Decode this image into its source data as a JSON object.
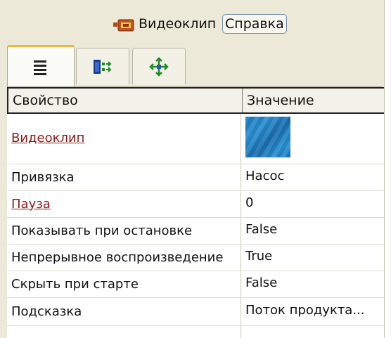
{
  "header": {
    "icon": "video-clip-icon",
    "title": "Видеоклип",
    "help_label": "Справка"
  },
  "tabs": [
    {
      "icon": "property-list-icon",
      "active": true
    },
    {
      "icon": "events-icon",
      "active": false
    },
    {
      "icon": "move-arrows-icon",
      "active": false
    }
  ],
  "grid": {
    "columns": [
      "Свойство",
      "Значение"
    ],
    "rows": [
      {
        "property": "Видеоклип",
        "value": "",
        "link": true,
        "value_type": "color-swatch"
      },
      {
        "property": "Привязка",
        "value": "Насос",
        "link": false
      },
      {
        "property": "Пауза",
        "value": "0",
        "link": true
      },
      {
        "property": "Показывать при остановке",
        "value": "False",
        "link": false
      },
      {
        "property": "Непрерывное воспроизведение",
        "value": "True",
        "link": false
      },
      {
        "property": "Скрыть при старте",
        "value": "False",
        "link": false
      },
      {
        "property": "Подсказка",
        "value": "Поток продукта...",
        "link": false
      }
    ]
  },
  "colors": {
    "panel_bg": "#ece9d8",
    "link_color": "#8b1a1a",
    "swatch_color": "#1e7fc4",
    "active_tab_accent": "#f0b63c"
  }
}
